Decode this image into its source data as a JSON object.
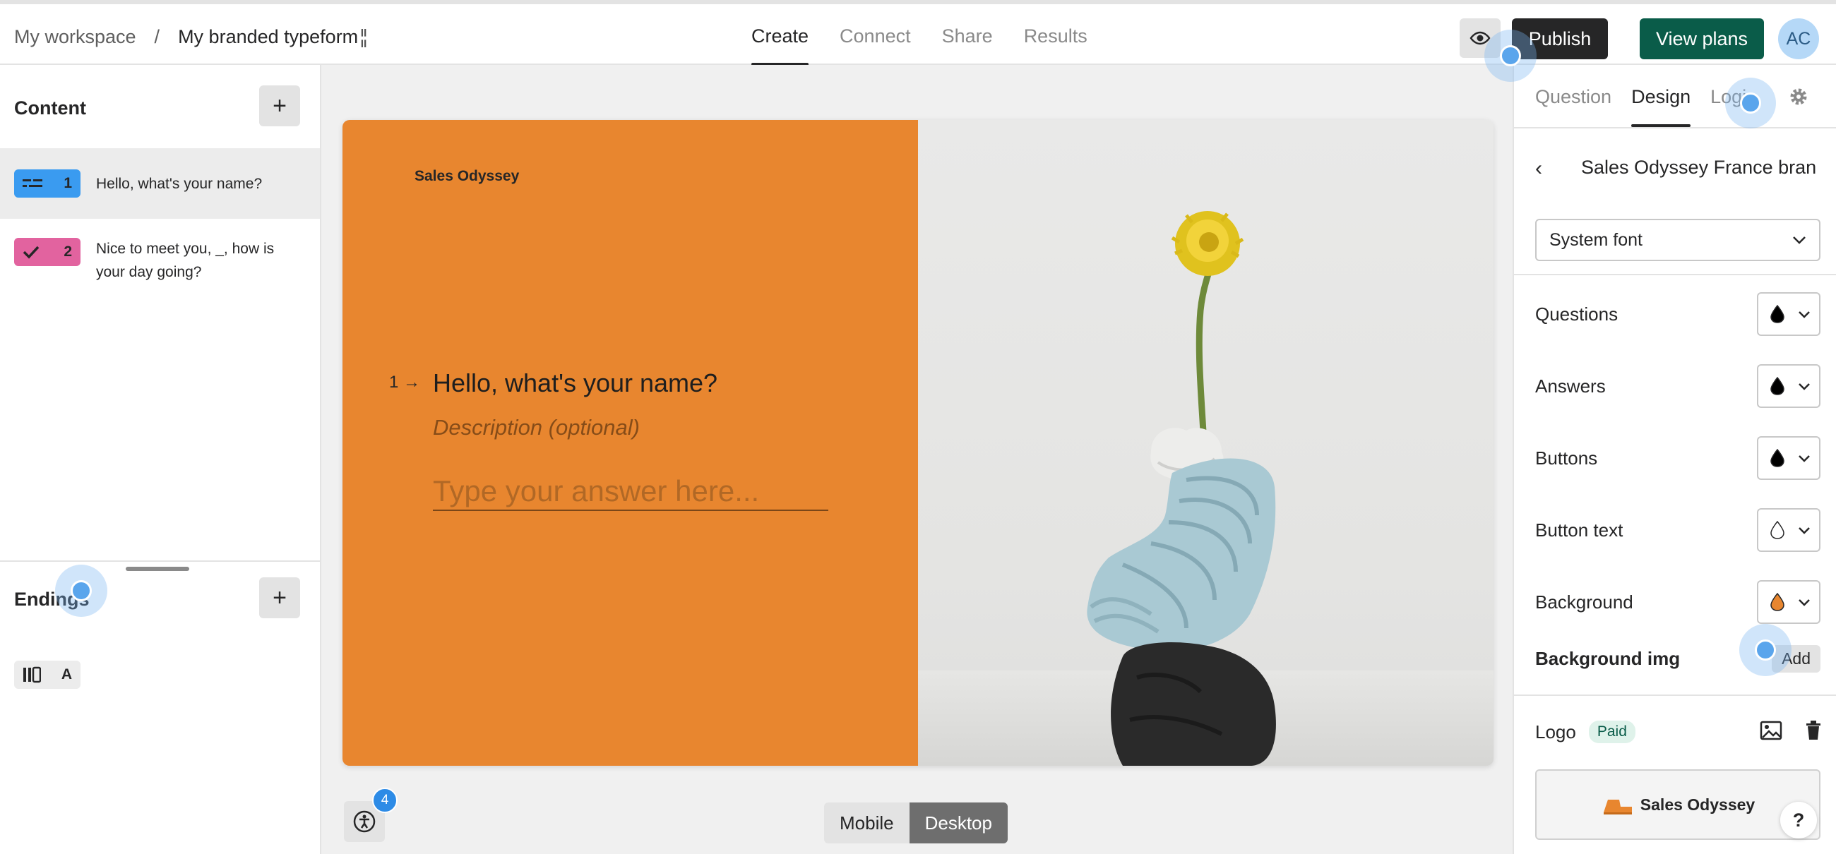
{
  "header": {
    "workspace": "My workspace",
    "separator": "/",
    "form_title": "My branded typeform",
    "tabs": [
      {
        "label": "Create",
        "active": true
      },
      {
        "label": "Connect",
        "active": false
      },
      {
        "label": "Share",
        "active": false
      },
      {
        "label": "Results",
        "active": false
      }
    ],
    "publish_label": "Publish",
    "view_plans_label": "View plans",
    "avatar_initials": "AC",
    "preview_icon": "eye-icon"
  },
  "sidebar": {
    "content_title": "Content",
    "add_label": "+",
    "questions": [
      {
        "number": "1",
        "text": "Hello, what's your name?",
        "type_icon": "short-text-icon",
        "color": "#3a9bf0"
      },
      {
        "number": "2",
        "text": "Nice to meet you, _, how is your day going?",
        "type_icon": "checkmark-icon",
        "color": "#e2639f"
      }
    ],
    "endings_title": "Endings",
    "ending_badge_letter": "A"
  },
  "preview": {
    "brand": "Sales Odyssey",
    "question_number": "1",
    "question_title": "Hello, what's your name?",
    "description_placeholder": "Description (optional)",
    "answer_placeholder": "Type your answer here...",
    "background_color": "#e8862f"
  },
  "canvas": {
    "accessibility_badge_count": "4",
    "device_options": [
      "Mobile",
      "Desktop"
    ],
    "selected_device": "Desktop"
  },
  "right_panel": {
    "tabs": [
      {
        "label": "Question",
        "active": false
      },
      {
        "label": "Design",
        "active": true
      },
      {
        "label": "Logic",
        "active": false
      }
    ],
    "theme_name": "Sales Odyssey France bran",
    "font_value": "System font",
    "color_rows": [
      {
        "label": "Questions",
        "color": "#000000"
      },
      {
        "label": "Answers",
        "color": "#000000"
      },
      {
        "label": "Buttons",
        "color": "#000000"
      },
      {
        "label": "Button text",
        "color": "#ffffff"
      },
      {
        "label": "Background",
        "color": "#e8862f"
      }
    ],
    "background_img_label": "Background img",
    "add_label": "Add",
    "logo_label": "Logo",
    "paid_label": "Paid",
    "logo_preview_text": "Sales Odyssey"
  },
  "help_label": "?"
}
